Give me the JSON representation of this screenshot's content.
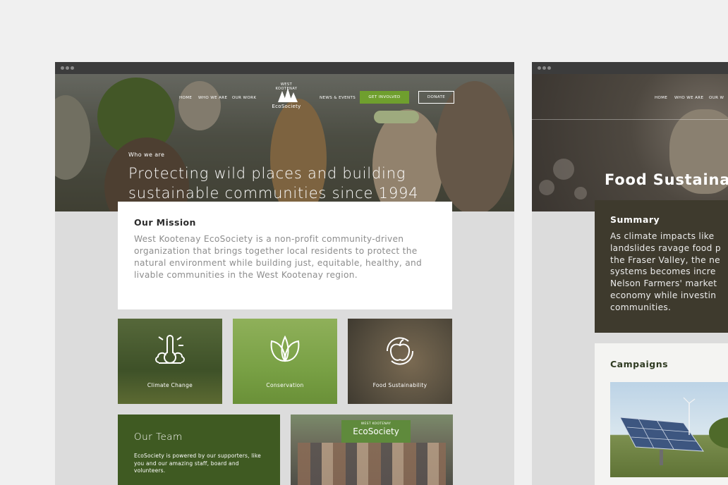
{
  "left": {
    "nav": {
      "home": "HOME",
      "who_we_are": "WHO WE ARE",
      "our_work": "OUR WORK",
      "news_events": "NEWS & EVENTS",
      "get_involved": "GET INVOLVED",
      "donate": "DONATE"
    },
    "logo": {
      "top": "WEST KOOTENAY",
      "main": "EcoSociety"
    },
    "hero": {
      "eyebrow": "Who we are",
      "title": "Protecting wild places and building sustainable communities since 1994"
    },
    "mission": {
      "heading": "Our Mission",
      "body": "West Kootenay EcoSociety is a non-profit community-driven organization that brings together local residents to protect the natural environment while building just, equitable, healthy, and livable communities in the West Kootenay region."
    },
    "tiles": [
      {
        "label": "Climate Change",
        "icon": "thermometer-icon",
        "color": "#4d5f30"
      },
      {
        "label": "Conservation",
        "icon": "leaf-icon",
        "color": "#7aa146"
      },
      {
        "label": "Food Sustainability",
        "icon": "apple-icon",
        "color": "#5a5141"
      }
    ],
    "team": {
      "heading": "Our Team",
      "body": "EcoSociety is powered by our supporters, like you and our amazing staff, board and volunteers."
    },
    "team_photo_banner": {
      "top": "WEST KOOTENAY",
      "main": "EcoSociety"
    }
  },
  "right": {
    "nav": {
      "home": "HOME",
      "who_we_are": "WHO WE ARE",
      "our_work": "OUR W"
    },
    "hero_title": "Food Sustainab",
    "summary": {
      "heading": "Summary",
      "lines": [
        "As climate impacts like",
        "landslides ravage food p",
        "the Fraser Valley, the ne",
        "systems becomes incre",
        "Nelson Farmers' market",
        "economy while investin",
        "communities."
      ]
    },
    "campaigns": {
      "heading": "Campaigns"
    }
  },
  "colors": {
    "accent_green": "#6f9f2e",
    "team_green": "#3f5a22",
    "summary_brown": "#3e3a2d"
  }
}
